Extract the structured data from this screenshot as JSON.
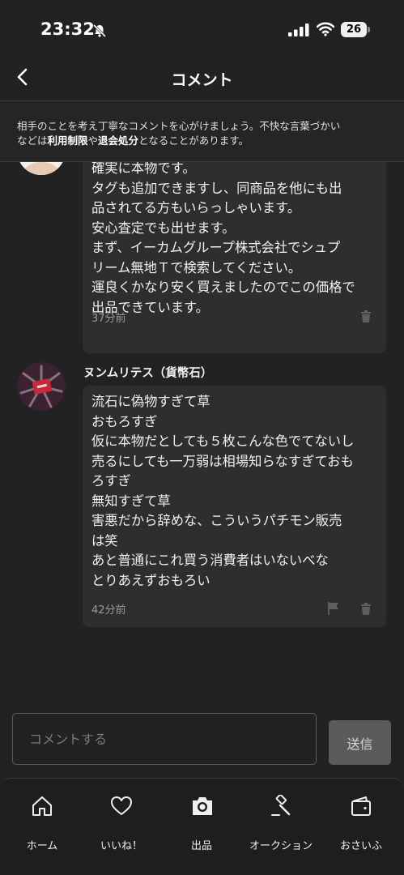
{
  "status_bar": {
    "time": "23:32",
    "battery": "26"
  },
  "header": {
    "title": "コメント"
  },
  "notice": {
    "line1": "相手のことを考え丁寧なコメントを心がけましょう。不快な言葉づかい",
    "line2_before": "などは",
    "link1": "利用制限",
    "line2_mid": "や",
    "link2": "退会処分",
    "line2_after": "となることがあります。"
  },
  "comments": [
    {
      "text": "確実に本物です。\nタグも追加できますし、同商品を他にも出\n品されてる方もいらっしゃいます。\n安心査定でも出せます。\nまず、イーカムグループ株式会社でシュプ\nリーム無地Ｔで検索してください。\n運良くかなり安く買えましたのでこの価格で\n出品できています。",
      "time": "37分前",
      "icons": [
        "trash-icon"
      ]
    },
    {
      "name": "ヌンムリテス（貨幣石）",
      "text": "流石に偽物すぎて草\nおもろすぎ\n仮に本物だとしても５枚こんな色でてないし\n売るにしても一万弱は相場知らなすぎておも\nろすぎ\n無知すぎて草\n害悪だから辞めな、こういうパチモン販売\nは笑\nあと普通にこれ買う消費者はいないべな\nとりあえずおもろい",
      "time": "42分前",
      "icons": [
        "flag-icon",
        "trash-icon"
      ]
    }
  ],
  "input": {
    "placeholder": "コメントする",
    "value": ""
  },
  "send_button": {
    "label": "送信"
  },
  "nav": [
    {
      "label": "ホーム",
      "icon": "home-icon"
    },
    {
      "label": "いいね！",
      "icon": "heart-icon"
    },
    {
      "label": "出品",
      "icon": "camera-icon"
    },
    {
      "label": "オークション",
      "icon": "gavel-icon"
    },
    {
      "label": "おさいふ",
      "icon": "wallet-icon"
    }
  ],
  "colors": {
    "background": "#222222",
    "bubble": "#2e2e2e",
    "send_disabled": "#5b5b5b",
    "text": "#f0f0f0",
    "muted": "#9a9a9a"
  }
}
